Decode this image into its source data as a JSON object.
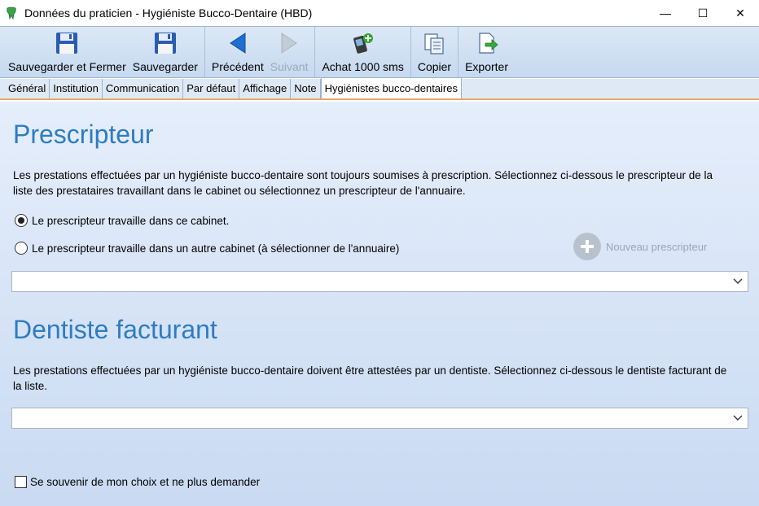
{
  "window": {
    "title": "Données du praticien - Hygiéniste Bucco-Dentaire (HBD)",
    "minimize_glyph": "—",
    "maximize_glyph": "☐",
    "close_glyph": "✕"
  },
  "toolbar": {
    "save_close_label": "Sauvegarder et Fermer",
    "save_label": "Sauvegarder",
    "previous_label": "Précédent",
    "next_label": "Suivant",
    "buy_sms_label": "Achat 1000 sms",
    "copy_label": "Copier",
    "export_label": "Exporter"
  },
  "tabs": [
    {
      "label": "Général"
    },
    {
      "label": "Institution"
    },
    {
      "label": "Communication"
    },
    {
      "label": "Par défaut"
    },
    {
      "label": "Affichage"
    },
    {
      "label": "Note"
    },
    {
      "label": "Hygiénistes bucco-dentaires",
      "active": true
    }
  ],
  "prescripteur": {
    "title": "Prescripteur",
    "description": "Les prestations effectuées par un hygiéniste bucco-dentaire sont toujours soumises à prescription. Sélectionnez ci-dessous le prescripteur de la liste des prestataires travaillant dans le cabinet ou sélectionnez un prescripteur de l'annuaire.",
    "option_same_cabinet": "Le prescripteur travaille dans ce cabinet.",
    "option_other_cabinet": "Le prescripteur travaille dans un autre cabinet (à sélectionner de l'annuaire)",
    "selected_option": "same_cabinet",
    "new_button_label": "Nouveau prescripteur",
    "combo_value": ""
  },
  "dentiste": {
    "title": "Dentiste facturant",
    "description": "Les prestations effectuées par un hygiéniste bucco-dentaire doivent être attestées par un dentiste. Sélectionnez ci-dessous le dentiste facturant de la liste.",
    "combo_value": ""
  },
  "remember_label": "Se souvenir de mon choix et ne plus demander",
  "remember_checked": false,
  "colors": {
    "heading": "#2e7cc0",
    "toolbar": "#c6d9f0",
    "tab_accent": "#e8a96a"
  }
}
